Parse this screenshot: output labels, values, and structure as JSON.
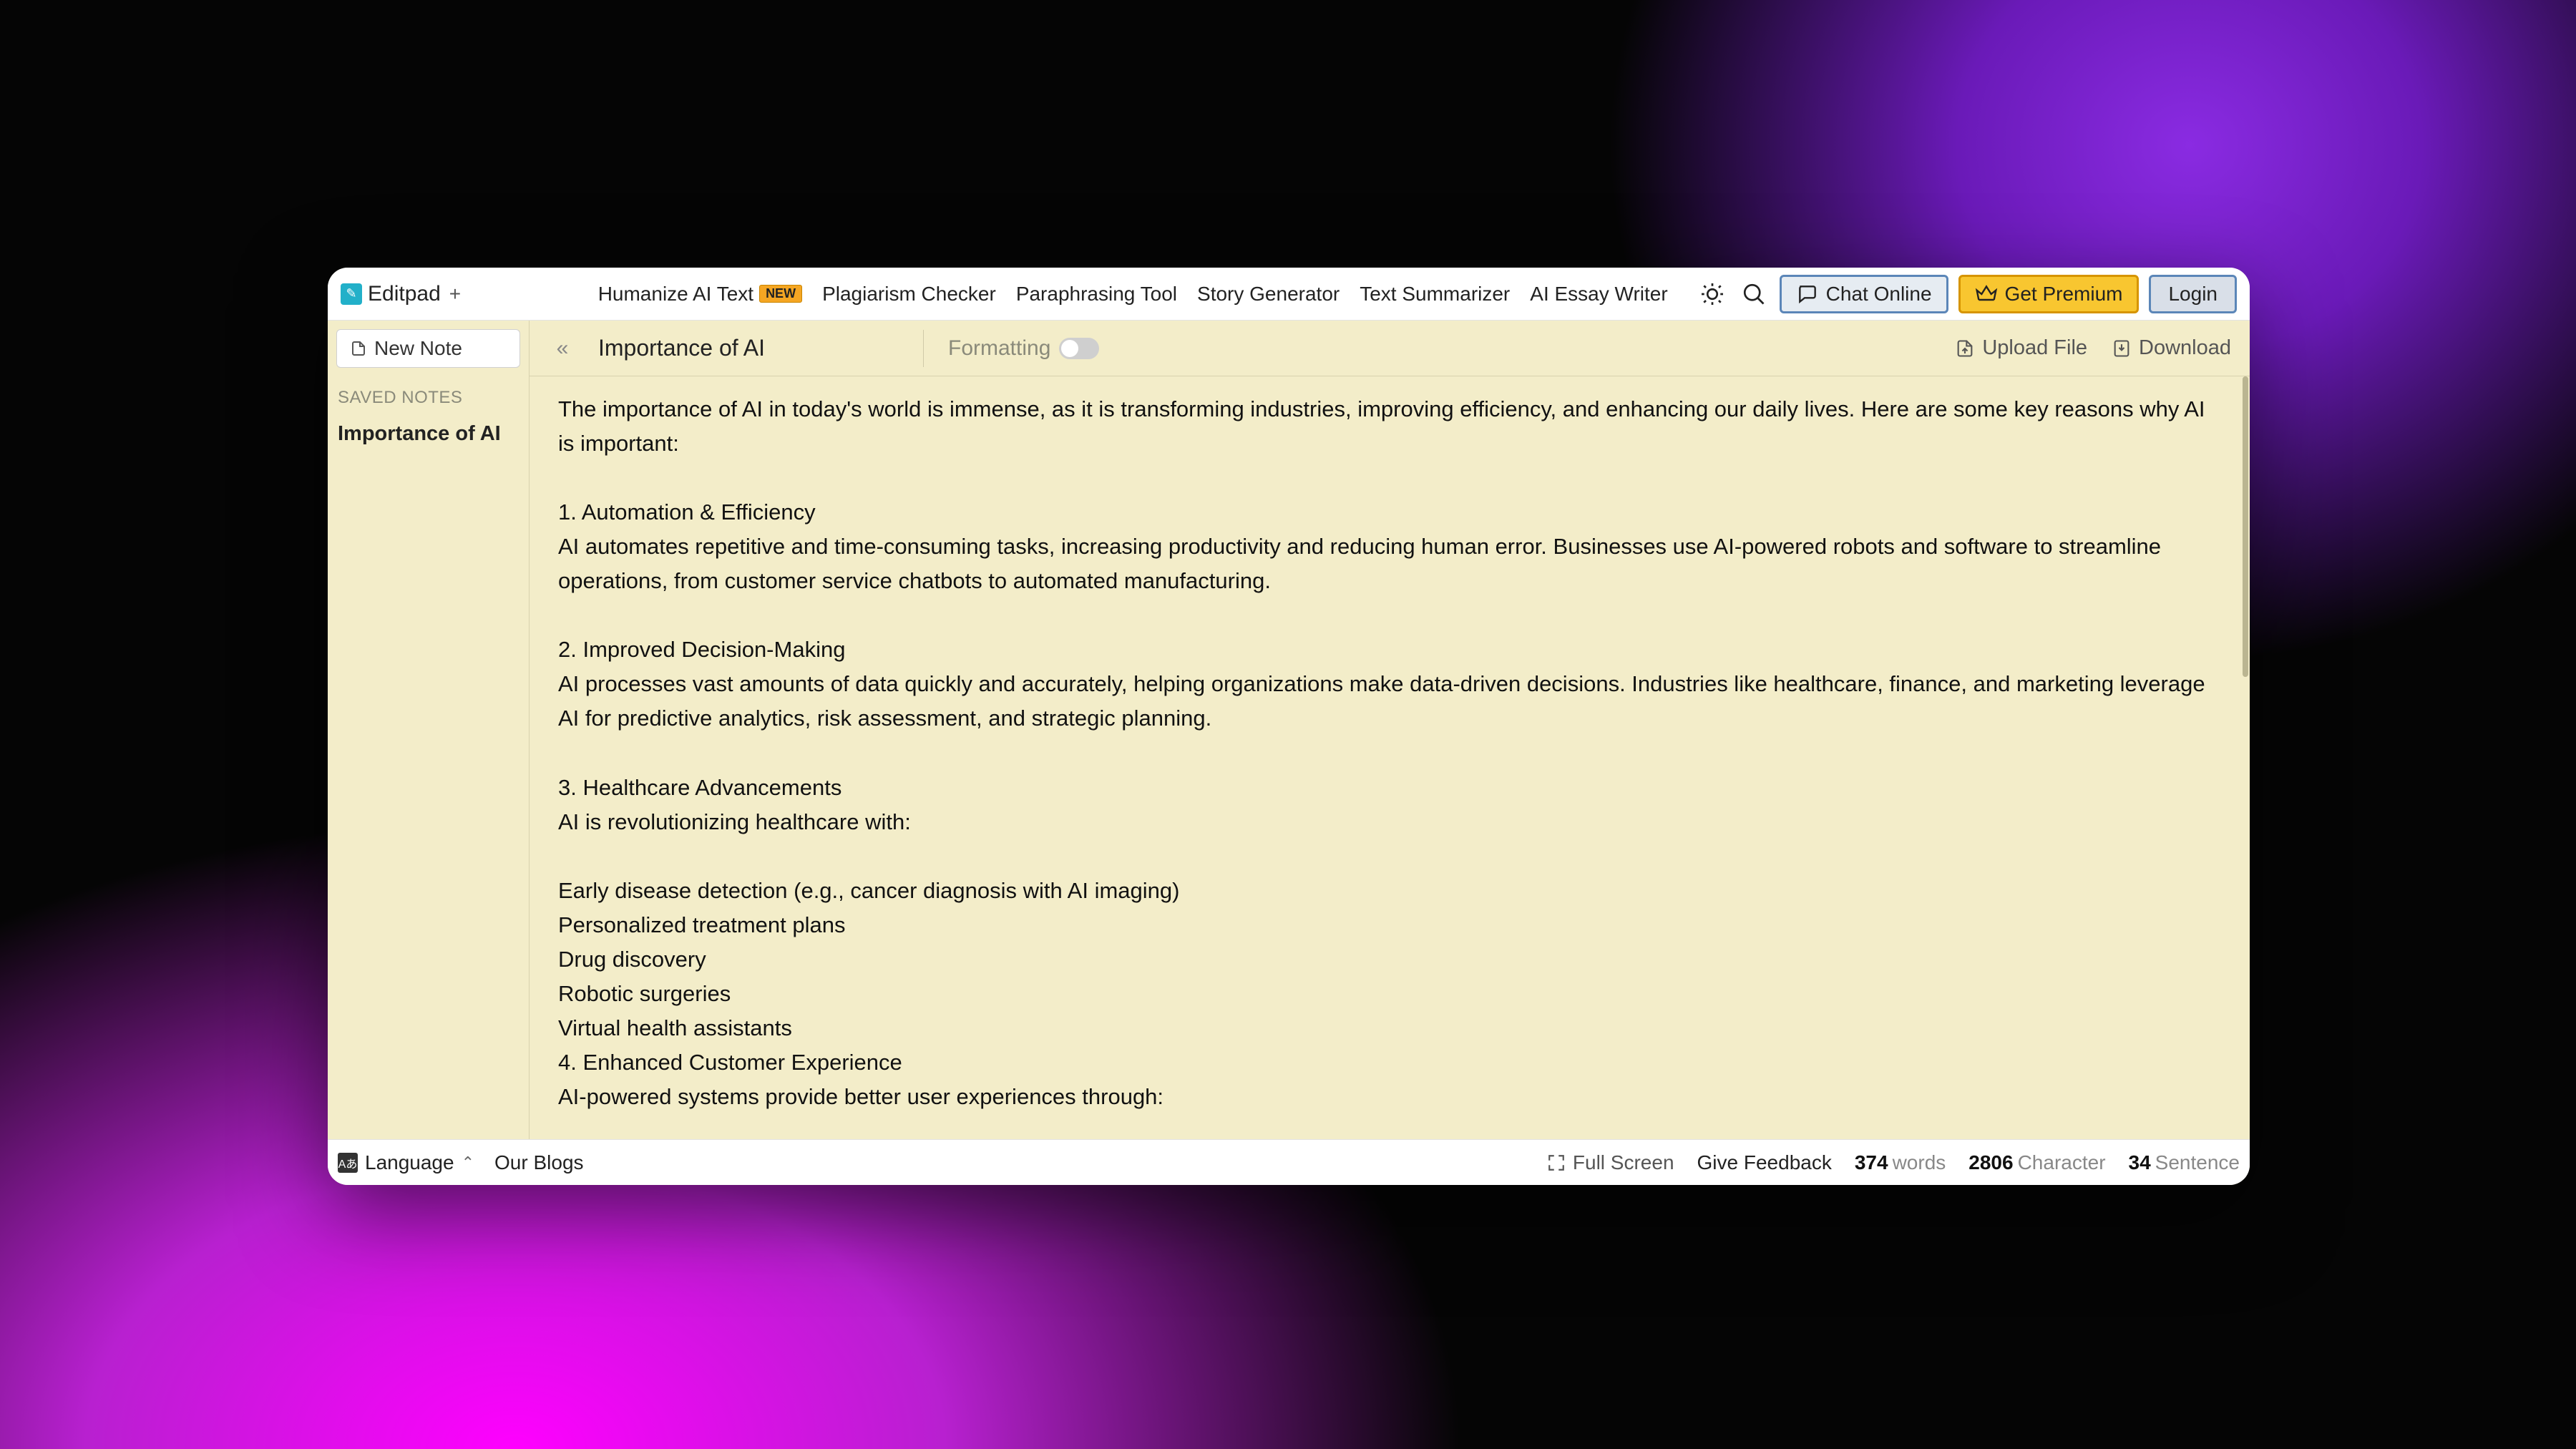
{
  "brand": "Editpad",
  "nav": [
    {
      "label": "Humanize AI Text",
      "badge": "NEW"
    },
    {
      "label": "Plagiarism Checker"
    },
    {
      "label": "Paraphrasing Tool"
    },
    {
      "label": "Story Generator"
    },
    {
      "label": "Text Summarizer"
    },
    {
      "label": "AI Essay Writer"
    }
  ],
  "topActions": {
    "chat": "Chat Online",
    "premium": "Get Premium",
    "login": "Login"
  },
  "sidebar": {
    "newNote": "New Note",
    "savedHeading": "SAVED NOTES",
    "items": [
      "Importance of AI"
    ]
  },
  "contentHeader": {
    "title": "Importance of AI",
    "formatting": "Formatting",
    "upload": "Upload File",
    "download": "Download"
  },
  "editor": {
    "intro": "The importance of AI in today's world is immense, as it is transforming industries, improving efficiency, and enhancing our daily lives. Here are some key reasons why AI is important:",
    "sec1_h": "1. Automation & Efficiency",
    "sec1_b": "AI automates repetitive and time-consuming tasks, increasing productivity and reducing human error. Businesses use AI-powered robots and software to streamline operations, from customer service chatbots to automated manufacturing.",
    "sec2_h": "2. Improved Decision-Making",
    "sec2_b": "AI processes vast amounts of data quickly and accurately, helping organizations make data-driven decisions. Industries like healthcare, finance, and marketing leverage AI for predictive analytics, risk assessment, and strategic planning.",
    "sec3_h": "3. Healthcare Advancements",
    "sec3_b": "AI is revolutionizing healthcare with:",
    "sec3_list": "Early disease detection (e.g., cancer diagnosis with AI imaging)\nPersonalized treatment plans\nDrug discovery\nRobotic surgeries\nVirtual health assistants\n4. Enhanced Customer Experience\nAI-powered systems provide better user experiences through:"
  },
  "footer": {
    "language": "Language",
    "blogs": "Our Blogs",
    "fullscreen": "Full Screen",
    "feedback": "Give Feedback",
    "words_n": "374",
    "words_l": "words",
    "chars_n": "2806",
    "chars_l": "Character",
    "sent_n": "34",
    "sent_l": "Sentence"
  }
}
